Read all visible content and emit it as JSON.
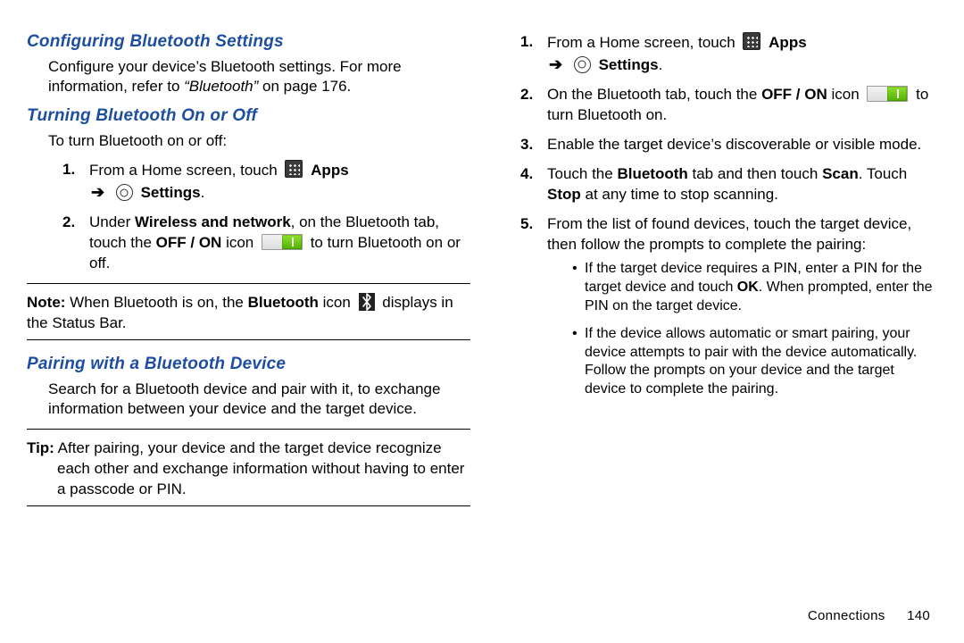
{
  "left": {
    "h_config": "Configuring Bluetooth Settings",
    "config_para_a": "Configure your device’s Bluetooth settings. For more information, refer to ",
    "config_ref": "“Bluetooth”",
    "config_para_b": " on page 176.",
    "h_turn": "Turning Bluetooth On or Off",
    "turn_intro": "To turn Bluetooth on or off:",
    "step1_a": "From a Home screen, touch ",
    "apps_word": "Apps",
    "settings_word": "Settings",
    "period": ".",
    "step2_a": "Under ",
    "step2_b": "Wireless and network",
    "step2_c": ", on the Bluetooth tab, touch the ",
    "step2_d": "OFF / ON",
    "step2_e": " icon ",
    "step2_f": " to turn Bluetooth on or off.",
    "note_label": "Note:",
    "note_a": " When Bluetooth is on, the ",
    "note_b": "Bluetooth",
    "note_c": " icon ",
    "note_d": " displays in the Status Bar.",
    "h_pair": "Pairing with a Bluetooth Device",
    "pair_para": "Search for a Bluetooth device and pair with it, to exchange information between your device and the target device.",
    "tip_label": "Tip:",
    "tip_body_a": " After pairing, your device and the target device recognize ",
    "tip_body_b": "each other and exchange information without having to enter a passcode or PIN."
  },
  "right": {
    "step1_a": "From a Home screen, touch ",
    "apps_word": "Apps",
    "settings_word": "Settings",
    "period": ".",
    "step2_a": "On the Bluetooth tab, touch the ",
    "step2_b": "OFF / ON",
    "step2_c": " icon ",
    "step2_d": " to turn Bluetooth on.",
    "step3": "Enable the target device’s discoverable or visible mode.",
    "step4_a": "Touch the ",
    "step4_b": "Bluetooth",
    "step4_c": " tab and then touch ",
    "step4_d": "Scan",
    "step4_e": ". Touch ",
    "step4_f": "Stop",
    "step4_g": " at any time to stop scanning.",
    "step5": "From the list of found devices, touch the target device, then follow the prompts to complete the pairing:",
    "bullet1_a": "If the target device requires a PIN, enter a PIN for the target device and touch ",
    "bullet1_b": "OK",
    "bullet1_c": ". When prompted, enter the PIN on the target device.",
    "bullet2": "If the device allows automatic or smart pairing, your device attempts to pair with the device automatically. Follow the prompts on your device and the target device to complete the pairing."
  },
  "footer": {
    "section": "Connections",
    "page": "140"
  },
  "nums": {
    "n1": "1.",
    "n2": "2.",
    "n3": "3.",
    "n4": "4.",
    "n5": "5."
  }
}
